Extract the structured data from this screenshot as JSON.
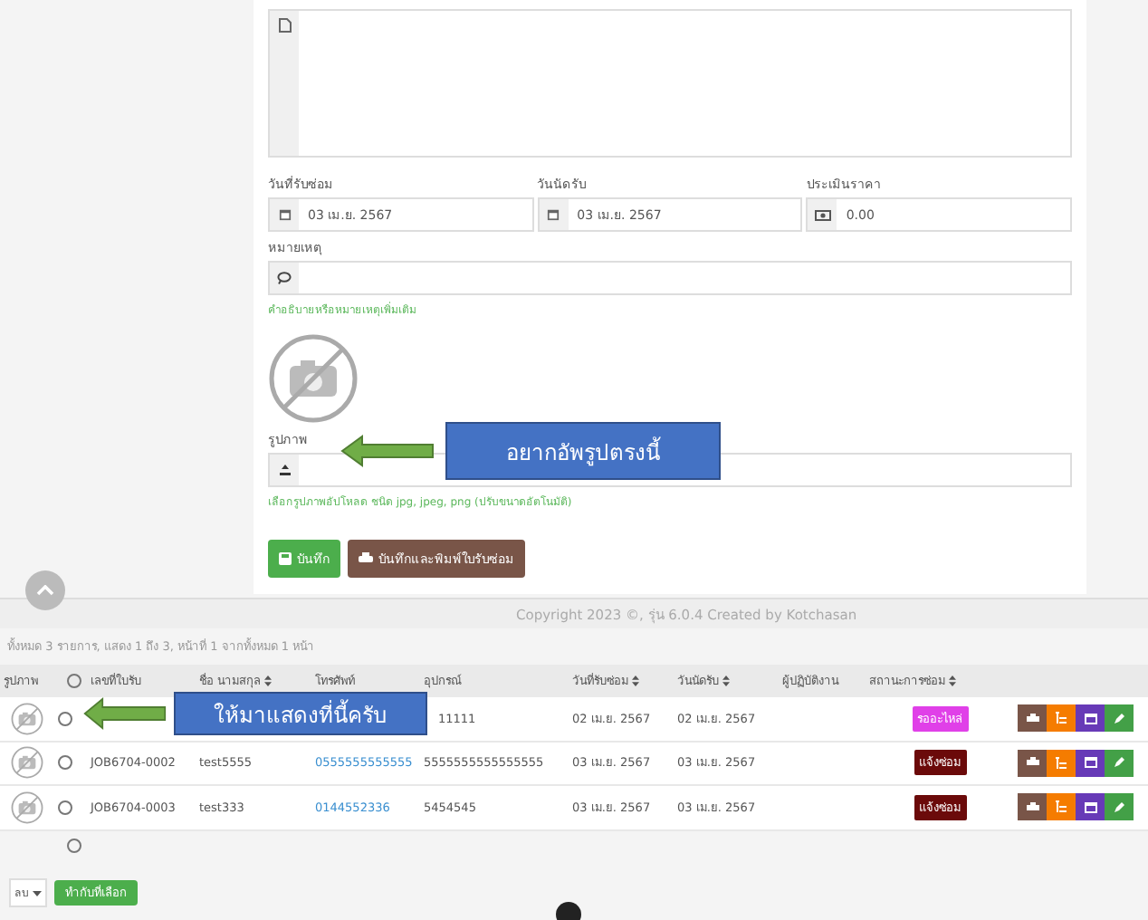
{
  "form": {
    "date_received": {
      "label": "วันที่รับซ่อม",
      "value": "03 เม.ย. 2567"
    },
    "appointment": {
      "label": "วันนัดรับ",
      "value": "03 เม.ย. 2567"
    },
    "estimate": {
      "label": "ประเมินราคา",
      "value": "0.00"
    },
    "note": {
      "label": "หมายเหตุ",
      "hint": "คำอธิบายหรือหมายเหตุเพิ่มเติม"
    },
    "image": {
      "label": "รูปภาพ",
      "hint": "เลือกรูปภาพอัปโหลด ชนิด jpg, jpeg, png (ปรับขนาดอัตโนมัติ)"
    },
    "buttons": [
      "บันทึก",
      "บันทึกและพิมพ์ใบรับซ่อม"
    ]
  },
  "callouts": [
    "อยากอัพรูปตรงนี้",
    "ให้มาแสดงที่นี้ครับ"
  ],
  "footer": "Copyright 2023 ©, รุ่น 6.0.4 Created by Kotchasan",
  "table": {
    "summary": "ทั้งหมด 3 รายการ, แสดง 1 ถึง 3, หน้าที่ 1 จากทั้งหมด 1 หน้า",
    "columns": [
      {
        "label": "รูปภาพ",
        "sortable": false
      },
      {
        "label": "เลขที่ใบรับ",
        "sortable": false
      },
      {
        "label": "ชื่อ นามสกุล",
        "sortable": true
      },
      {
        "label": "โทรศัพท์",
        "sortable": false
      },
      {
        "label": "อุปกรณ์",
        "sortable": false
      },
      {
        "label": "วันที่รับซ่อม",
        "sortable": true
      },
      {
        "label": "วันนัดรับ",
        "sortable": true
      },
      {
        "label": "ผู้ปฏิบัติงาน",
        "sortable": false
      },
      {
        "label": "สถานะการซ่อม",
        "sortable": true
      }
    ],
    "rows": [
      {
        "equipment": "11111",
        "received": "02 เม.ย. 2567",
        "appointment": "02 เม.ย. 2567",
        "status": "รออะไหล่",
        "color": "#e040e8",
        "checked": false
      },
      {
        "job": "JOB6704-0002",
        "name": "test5555",
        "phone": "0555555555555",
        "equipment": "5555555555555555",
        "received": "03 เม.ย. 2567",
        "appointment": "03 เม.ย. 2567",
        "status": "แจ้งซ่อม",
        "color": "#6b0a0a",
        "checked": false
      },
      {
        "job": "JOB6704-0003",
        "name": "test333",
        "phone": "0144552336",
        "equipment": "5454545",
        "received": "03 เม.ย. 2567",
        "appointment": "03 เม.ย. 2567",
        "status": "แจ้งซ่อม",
        "color": "#6b0a0a",
        "checked": false
      }
    ],
    "select_all": {
      "checked": false
    },
    "footer_checkbox": {
      "checked": false
    },
    "action": {
      "select": "ลบ",
      "button": "ทำกับที่เลือก"
    }
  }
}
